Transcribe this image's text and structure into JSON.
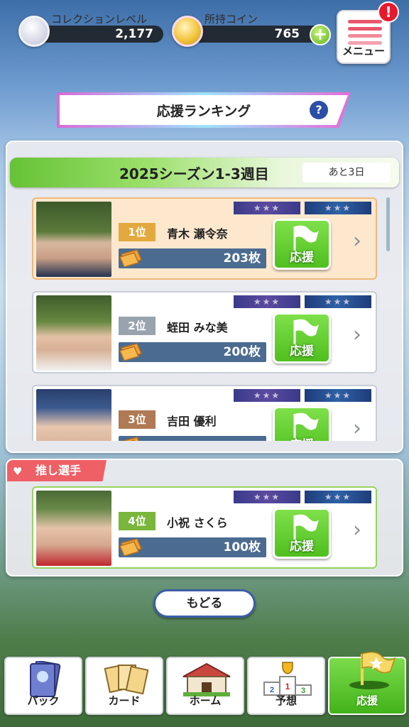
{
  "header": {
    "collection_label": "コレクションレベル",
    "collection_value": "2,177",
    "coin_label": "所持コイン",
    "coin_value": "765",
    "add_coin": "+",
    "menu_label": "メニュー",
    "alert": "!"
  },
  "title": {
    "text": "応援ランキング",
    "help": "?"
  },
  "season": {
    "label": "2025シーズン1-3週目",
    "remaining": "あと3日"
  },
  "ranking": [
    {
      "rank": "1位",
      "name": "青木 瀬令奈",
      "count": "203枚",
      "cheer": "応援",
      "rank_color": "#e3a93e",
      "stars_left": "★★★",
      "stars_right": "★★★"
    },
    {
      "rank": "2位",
      "name": "蛭田 みな美",
      "count": "200枚",
      "cheer": "応援",
      "rank_color": "#98a3ad",
      "stars_left": "★★★",
      "stars_right": "★★★"
    },
    {
      "rank": "3位",
      "name": "吉田 優利",
      "count": "",
      "cheer": "応援",
      "rank_color": "#b07a54",
      "stars_left": "★★★",
      "stars_right": "★★★"
    }
  ],
  "favorite": {
    "tag": "推し選手",
    "rank": "4位",
    "name": "小祝 さくら",
    "count": "100枚",
    "cheer": "応援",
    "rank_color": "#79b63b",
    "stars_left": "★★★",
    "stars_right": "★★★"
  },
  "back_label": "もどる",
  "nav": [
    {
      "label": "パック",
      "icon": "pack-icon"
    },
    {
      "label": "カード",
      "icon": "cards-icon"
    },
    {
      "label": "ホーム",
      "icon": "house-icon"
    },
    {
      "label": "予想",
      "icon": "podium-icon"
    },
    {
      "label": "応援",
      "icon": "flag-icon",
      "active": true
    }
  ],
  "colors": {
    "accent_green": "#5ec02b",
    "count_bar": "#4b6b91",
    "fav_tag": "#ef5f66"
  }
}
